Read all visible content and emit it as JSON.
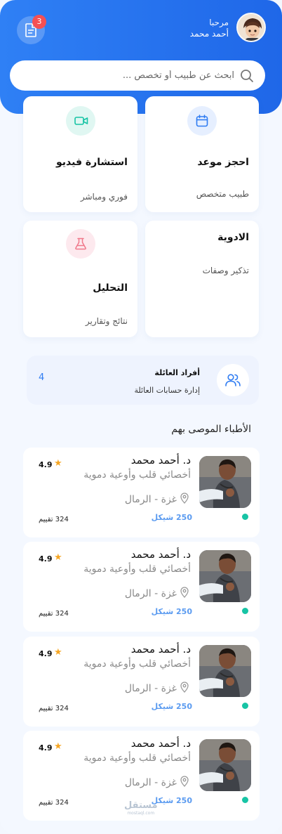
{
  "header": {
    "greeting": "مرحبا",
    "user_name": "أحمد محمد",
    "notification_count": "3"
  },
  "search": {
    "placeholder": "ابحث عن طبيب أو تخصص ..."
  },
  "tiles": {
    "book": {
      "title": "احجز موعد",
      "subtitle": "طبيب متخصص",
      "icon": "calendar-icon"
    },
    "video": {
      "title": "استشارة فيديو",
      "subtitle": "فوري ومباشر",
      "icon": "video-icon"
    },
    "meds": {
      "title": "الادوية",
      "subtitle": "تذكير وصفات",
      "icon": ""
    },
    "lab": {
      "title": "التحليل",
      "subtitle": "نتائج وتقارير",
      "icon": "flask-icon"
    }
  },
  "family": {
    "title": "أفراد العائلة",
    "subtitle": "إدارة حسابات العائلة",
    "count": "4",
    "icon": "users-icon"
  },
  "recommended": {
    "title": "الأطباء الموصى بهم",
    "doctors": [
      {
        "name": "د. أحمد محمد",
        "specialty": "أخصائي قلب وأوعية دموية",
        "location": "غزة - الرمال",
        "price": "250 شيكل",
        "rating": "4.9",
        "reviews": "324 تقييم"
      },
      {
        "name": "د. أحمد محمد",
        "specialty": "أخصائي قلب وأوعية دموية",
        "location": "غزة - الرمال",
        "price": "250 شيكل",
        "rating": "4.9",
        "reviews": "324 تقييم"
      },
      {
        "name": "د. أحمد محمد",
        "specialty": "أخصائي قلب وأوعية دموية",
        "location": "غزة - الرمال",
        "price": "250 شيكل",
        "rating": "4.9",
        "reviews": "324 تقييم"
      },
      {
        "name": "د. أحمد محمد",
        "specialty": "أخصائي قلب وأوعية دموية",
        "location": "غزة - الرمال",
        "price": "250 شيكل",
        "rating": "4.9",
        "reviews": "324 تقييم"
      }
    ]
  },
  "watermark": {
    "text": "مستقل",
    "sub": "mostaql.com"
  },
  "colors": {
    "primary": "#2f80f5",
    "accent_green": "#17c4a5",
    "badge": "#f55055",
    "star": "#f6a623"
  }
}
